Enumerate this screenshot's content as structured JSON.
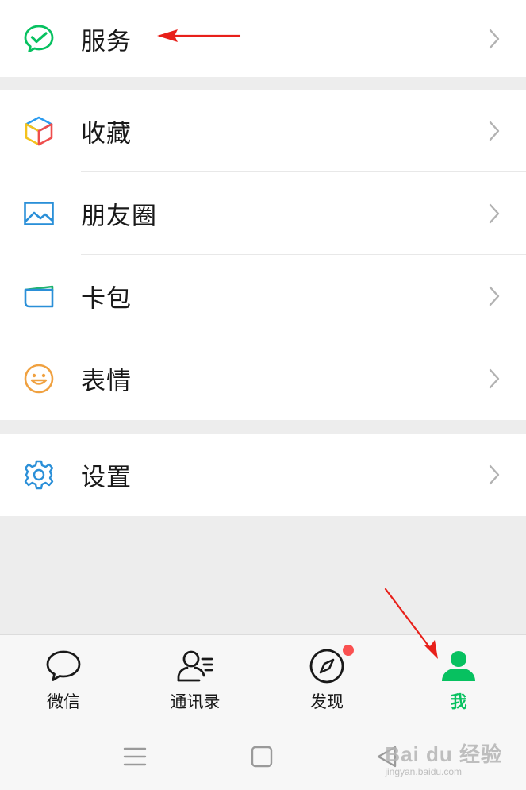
{
  "menu_groups": [
    {
      "items": [
        {
          "label": "服务",
          "icon": "wechat-pay-icon"
        }
      ]
    },
    {
      "items": [
        {
          "label": "收藏",
          "icon": "favorites-cube-icon"
        },
        {
          "label": "朋友圈",
          "icon": "moments-picture-icon"
        },
        {
          "label": "卡包",
          "icon": "card-wallet-icon"
        },
        {
          "label": "表情",
          "icon": "sticker-smiley-icon"
        }
      ]
    },
    {
      "items": [
        {
          "label": "设置",
          "icon": "settings-gear-icon"
        }
      ]
    }
  ],
  "tabbar": {
    "tabs": [
      {
        "label": "微信",
        "icon": "chat-bubble-icon"
      },
      {
        "label": "通讯录",
        "icon": "contacts-icon"
      },
      {
        "label": "发现",
        "icon": "discover-compass-icon"
      },
      {
        "label": "我",
        "icon": "me-person-icon"
      }
    ],
    "active_tab": "我",
    "accent_color": "#07c160",
    "badge_color": "#fa5151"
  },
  "system_nav": {
    "buttons": [
      "menu-icon",
      "home-square-icon",
      "back-triangle-icon"
    ]
  },
  "watermark": {
    "main": "Bai du 经验",
    "sub": "jingyan.baidu.com"
  },
  "annotation_arrow_color": "#e8201a"
}
